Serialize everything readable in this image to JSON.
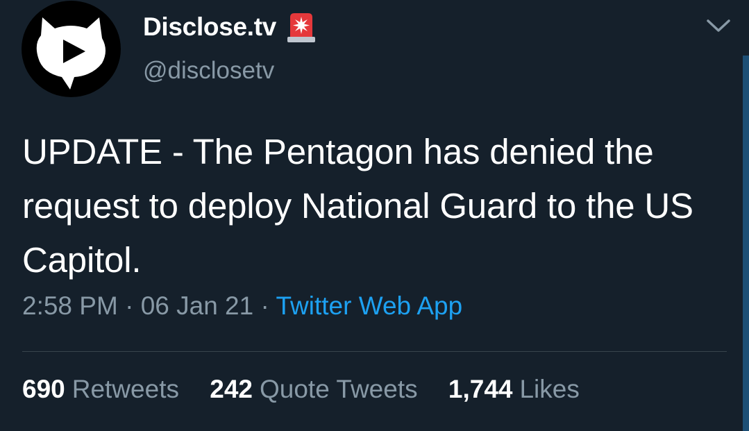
{
  "account": {
    "display_name": "Disclose.tv",
    "handle": "@disclosetv",
    "avatar_icon": "cat-play-logo-icon",
    "badge_icon": "siren-icon"
  },
  "tweet": {
    "text": "UPDATE - The Pentagon has denied the request to deploy National Guard to the US Capitol.",
    "time": "2:58 PM",
    "separator": "·",
    "date": "06 Jan 21",
    "source": "Twitter Web App"
  },
  "stats": {
    "retweets_count": "690",
    "retweets_label": "Retweets",
    "quotes_count": "242",
    "quotes_label": "Quote Tweets",
    "likes_count": "1,744",
    "likes_label": "Likes"
  },
  "colors": {
    "background": "#15202b",
    "secondary_text": "#8899a6",
    "link": "#1da1f2",
    "divider": "#38444d"
  }
}
